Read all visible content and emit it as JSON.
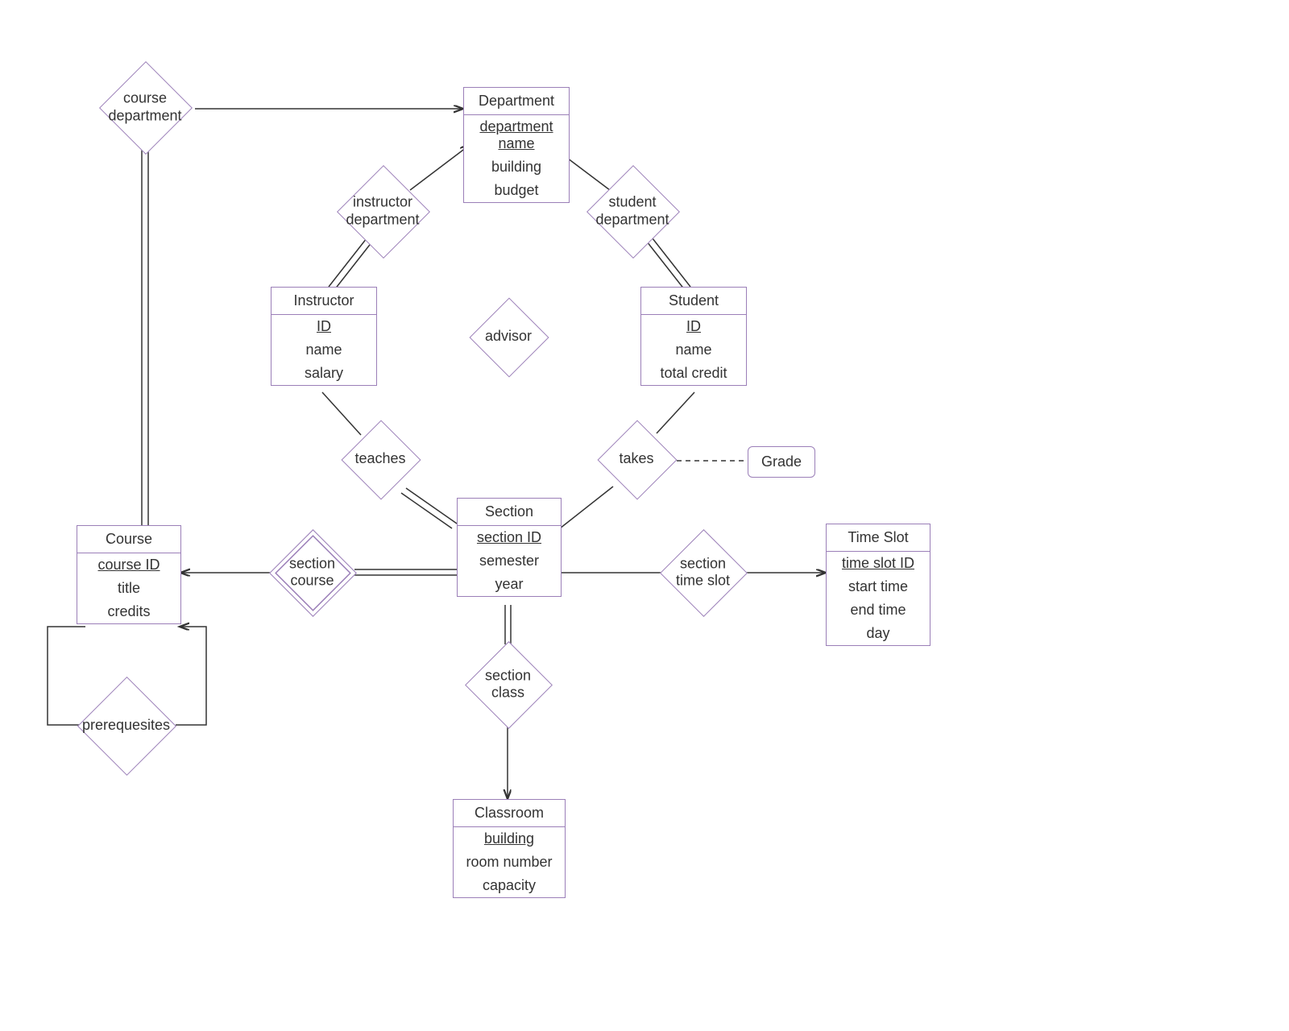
{
  "entities": {
    "department": {
      "title": "Department",
      "attrs": [
        "department name",
        "building",
        "budget"
      ],
      "keyIdx": 0
    },
    "instructor": {
      "title": "Instructor",
      "attrs": [
        "ID",
        "name",
        "salary"
      ],
      "keyIdx": 0
    },
    "student": {
      "title": "Student",
      "attrs": [
        "ID",
        "name",
        "total credit"
      ],
      "keyIdx": 0
    },
    "section": {
      "title": "Section",
      "attrs": [
        "section ID",
        "semester",
        "year"
      ],
      "keyIdx": 0
    },
    "course": {
      "title": "Course",
      "attrs": [
        "course ID",
        "title",
        "credits"
      ],
      "keyIdx": 0
    },
    "timeslot": {
      "title": "Time Slot",
      "attrs": [
        "time slot ID",
        "start time",
        "end time",
        "day"
      ],
      "keyIdx": 0
    },
    "classroom": {
      "title": "Classroom",
      "attrs": [
        "building",
        "room number",
        "capacity"
      ],
      "keyIdx": 0
    }
  },
  "relationships": {
    "course_department": {
      "label": "course\ndepartment"
    },
    "instructor_department": {
      "label": "instructor\ndepartment"
    },
    "student_department": {
      "label": "student\ndepartment"
    },
    "advisor": {
      "label": "advisor"
    },
    "teaches": {
      "label": "teaches"
    },
    "takes": {
      "label": "takes"
    },
    "section_course": {
      "label": "section\ncourse"
    },
    "section_timeslot": {
      "label": "section\ntime slot"
    },
    "section_class": {
      "label": "section\nclass"
    },
    "prerequisites": {
      "label": "prerequesites"
    }
  },
  "attribute_nodes": {
    "grade": {
      "label": "Grade"
    }
  }
}
